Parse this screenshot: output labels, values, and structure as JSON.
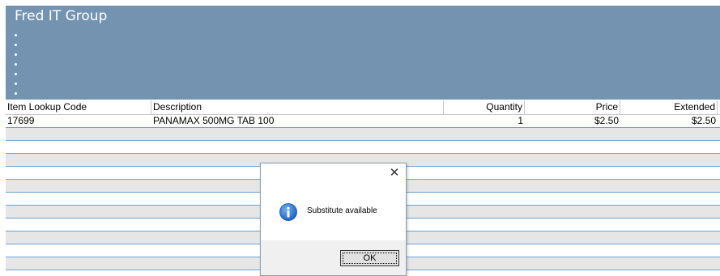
{
  "header": {
    "title": "Fred IT Group",
    "bullet_count": 7
  },
  "grid": {
    "columns": [
      "Item Lookup Code",
      "Description",
      "Quantity",
      "Price",
      "Extended"
    ],
    "rows": [
      {
        "item_lookup_code": "17699",
        "description": "PANAMAX 500MG TAB 100",
        "quantity": "1",
        "price": "$2.50",
        "extended": "$2.50"
      }
    ],
    "empty_row_count": 11
  },
  "dialog": {
    "message": "Substitute available",
    "ok_label": "OK",
    "close_icon": "close-icon",
    "message_icon": "info-icon"
  },
  "colors": {
    "banner": "#7393b0",
    "row_alt": "#e6e6e6",
    "row_line": "#6aa3d6",
    "info_icon": "#1c64c8"
  }
}
